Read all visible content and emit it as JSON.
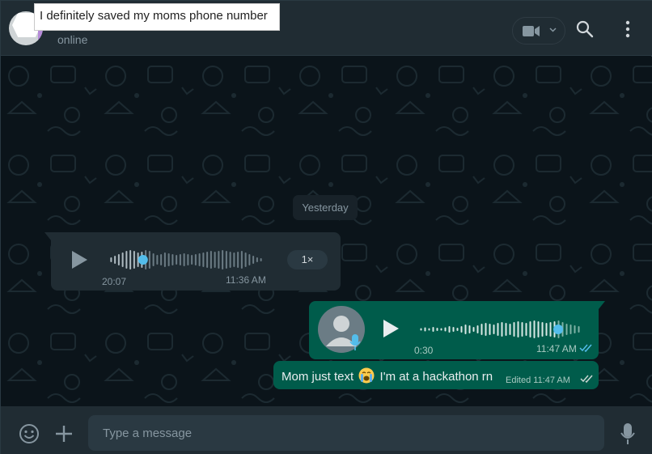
{
  "header": {
    "caption": "I definitely saved my moms phone number",
    "status": "online"
  },
  "messages": {
    "date_chip": "Yesterday",
    "incoming_voice": {
      "duration": "20:07",
      "time": "11:36 AM",
      "speed": "1×",
      "progress": 0.22
    },
    "outgoing_voice": {
      "duration": "0:30",
      "time": "11:47 AM",
      "progress": 0.86
    },
    "outgoing_text": {
      "text_before_emoji": "Mom just text",
      "emoji": "loudly-crying-face",
      "text_after_emoji": "I'm at a hackathon rn",
      "edited_label": "Edited",
      "time": "11:47 AM"
    }
  },
  "composer": {
    "placeholder": "Type a message"
  },
  "colors": {
    "header_bg": "#202c33",
    "chat_bg": "#0b141a",
    "incoming_bubble": "#202c33",
    "outgoing_bubble": "#005c4b",
    "accent_blue": "#53bdeb",
    "tick_blue": "#53bdeb"
  }
}
